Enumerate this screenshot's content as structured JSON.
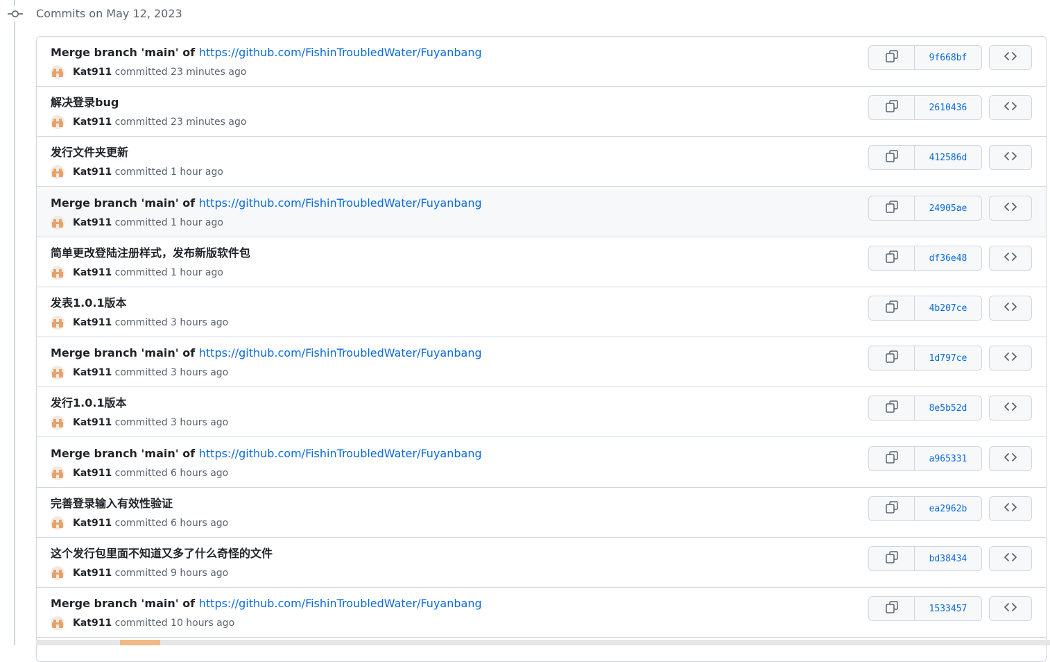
{
  "date_header": "Commits on May 12, 2023",
  "commits": [
    {
      "prefix": "Merge branch 'main' of ",
      "link": "https://github.com/FishinTroubledWater/Fuyanbang",
      "message": "",
      "author": "Kat911",
      "action": "committed",
      "time": "23 minutes ago",
      "sha": "9f668bf"
    },
    {
      "prefix": "",
      "link": "",
      "message": "解决登录bug",
      "author": "Kat911",
      "action": "committed",
      "time": "23 minutes ago",
      "sha": "2610436"
    },
    {
      "prefix": "",
      "link": "",
      "message": "发行文件夹更新",
      "author": "Kat911",
      "action": "committed",
      "time": "1 hour ago",
      "sha": "412586d"
    },
    {
      "prefix": "Merge branch 'main' of ",
      "link": "https://github.com/FishinTroubledWater/Fuyanbang",
      "message": "",
      "author": "Kat911",
      "action": "committed",
      "time": "1 hour ago",
      "sha": "24905ae"
    },
    {
      "prefix": "",
      "link": "",
      "message": "简单更改登陆注册样式，发布新版软件包",
      "author": "Kat911",
      "action": "committed",
      "time": "1 hour ago",
      "sha": "df36e48"
    },
    {
      "prefix": "",
      "link": "",
      "message": "发表1.0.1版本",
      "author": "Kat911",
      "action": "committed",
      "time": "3 hours ago",
      "sha": "4b207ce"
    },
    {
      "prefix": "Merge branch 'main' of ",
      "link": "https://github.com/FishinTroubledWater/Fuyanbang",
      "message": "",
      "author": "Kat911",
      "action": "committed",
      "time": "3 hours ago",
      "sha": "1d797ce"
    },
    {
      "prefix": "",
      "link": "",
      "message": "发行1.0.1版本",
      "author": "Kat911",
      "action": "committed",
      "time": "3 hours ago",
      "sha": "8e5b52d"
    },
    {
      "prefix": "Merge branch 'main' of ",
      "link": "https://github.com/FishinTroubledWater/Fuyanbang",
      "message": "",
      "author": "Kat911",
      "action": "committed",
      "time": "6 hours ago",
      "sha": "a965331"
    },
    {
      "prefix": "",
      "link": "",
      "message": "完善登录输入有效性验证",
      "author": "Kat911",
      "action": "committed",
      "time": "6 hours ago",
      "sha": "ea2962b"
    },
    {
      "prefix": "",
      "link": "",
      "message": "这个发行包里面不知道又多了什么奇怪的文件",
      "author": "Kat911",
      "action": "committed",
      "time": "9 hours ago",
      "sha": "bd38434"
    },
    {
      "prefix": "Merge branch 'main' of ",
      "link": "https://github.com/FishinTroubledWater/Fuyanbang",
      "message": "",
      "author": "Kat911",
      "action": "committed",
      "time": "10 hours ago",
      "sha": "1533457"
    }
  ],
  "hovered_index": 3,
  "icons": {
    "timeline": "git-commit-icon",
    "copy": "copy-icon",
    "browse": "code-icon"
  },
  "colors": {
    "link": "#0969da",
    "muted": "#59636e",
    "border": "#d0d7de",
    "button_bg": "#f6f8fa"
  }
}
